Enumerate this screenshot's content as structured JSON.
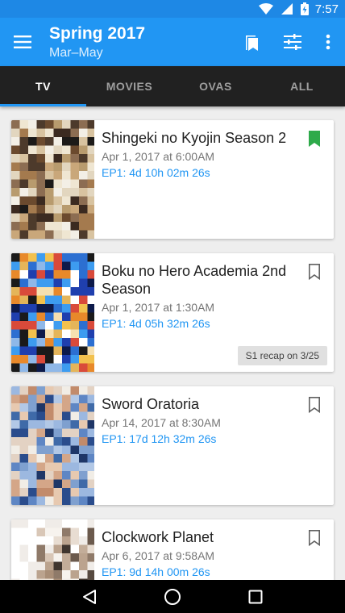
{
  "status_bar": {
    "time": "7:57",
    "icons": [
      "wifi-icon",
      "signal-icon",
      "battery-icon"
    ]
  },
  "app_bar": {
    "title": "Spring 2017",
    "subtitle": "Mar–May",
    "actions": [
      "bookmarks-icon",
      "filter-icon",
      "more-vert-icon"
    ]
  },
  "tabs": [
    {
      "label": "TV",
      "active": true
    },
    {
      "label": "MOVIES",
      "active": false
    },
    {
      "label": "OVAS",
      "active": false
    },
    {
      "label": "ALL",
      "active": false
    }
  ],
  "colors": {
    "primary": "#2196f3",
    "primary_dark": "#1e88e5",
    "bookmarked": "#2eaa4a",
    "tab_bar": "#212121"
  },
  "cards": [
    {
      "title": "Shingeki no Kyojin Season 2",
      "date": "Apr 1, 2017 at 6:00AM",
      "countdown": "EP1: 4d 10h 02m 26s",
      "bookmarked": true,
      "note": ""
    },
    {
      "title": "Boku no Hero Academia 2nd Season",
      "date": "Apr 1, 2017 at 1:30AM",
      "countdown": "EP1: 4d 05h 32m 26s",
      "bookmarked": false,
      "note": "S1 recap on 3/25"
    },
    {
      "title": "Sword Oratoria",
      "date": "Apr 14, 2017 at 8:30AM",
      "countdown": "EP1: 17d 12h 32m 26s",
      "bookmarked": false,
      "note": ""
    },
    {
      "title": "Clockwork Planet",
      "date": "Apr 6, 2017 at 9:58AM",
      "countdown": "EP1: 9d 14h 00m 26s",
      "bookmarked": false,
      "note": ""
    }
  ],
  "nav_bar": [
    "back-icon",
    "home-icon",
    "recents-icon"
  ]
}
